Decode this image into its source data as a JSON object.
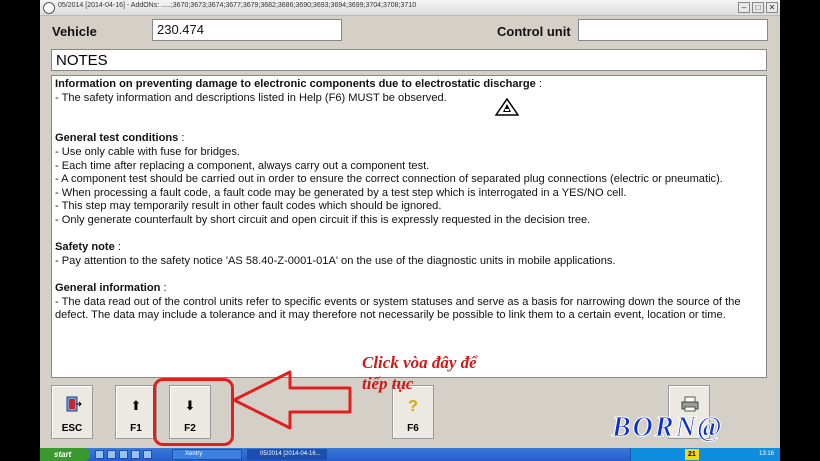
{
  "window": {
    "title": "05/2014 [2014-04-16] - AddONs: .....;3670;3673;3674;3677;3679;3682;3686;3690;3693;3694;3699;3704;3708;3710",
    "minimize": "–",
    "maximize": "□",
    "close": "✕"
  },
  "header": {
    "vehicle_label": "Vehicle",
    "vehicle_value": "230.474",
    "control_unit_label": "Control unit",
    "control_unit_value": ""
  },
  "notes": {
    "title": "NOTES",
    "sections": [
      {
        "heading": "Information on preventing damage to electronic components due to electrostatic discharge",
        "suffix": " :",
        "lines": [
          "- The safety information and descriptions listed in Help (F6) MUST be observed."
        ]
      },
      {
        "heading": "General test conditions",
        "suffix": " :",
        "lines": [
          "- Use only cable with fuse for bridges.",
          "- Each time after replacing a component, always carry out a component test.",
          "- A component test should be carried out in order to ensure the correct connection of separated plug connections (electric or pneumatic).",
          "- When processing a fault code, a fault code may be generated by a test step which is interrogated in a YES/NO cell.",
          "- This step may temporarily result in other fault codes which should be ignored.",
          "- Only generate counterfault by short circuit and open circuit if this is expressly requested in the decision tree."
        ]
      },
      {
        "heading": "Safety note",
        "suffix": " :",
        "lines": [
          "- Pay attention to the safety notice 'AS 58.40-Z-0001-01A' on the use of the diagnostic units in mobile applications."
        ]
      },
      {
        "heading": "General information",
        "suffix": " :",
        "lines": [
          "- The data read out of the control units refer to specific events or system statuses and serve as a basis for narrowing down the source of the defect. The data may include a tolerance and it may therefore not necessarily be possible to link them to a certain event, location or time."
        ]
      }
    ]
  },
  "buttons": {
    "esc": "ESC",
    "f1": "F1",
    "f2": "F2",
    "f6": "F6",
    "f1_glyph": "⬆",
    "f2_glyph": "⬇",
    "f6_glyph": "?"
  },
  "annotation": {
    "line1": "Click vòa đây để",
    "line2": "tiếp tục",
    "color": "#d01818"
  },
  "watermark": "BORN@",
  "taskbar": {
    "start": "start",
    "task1": "Xentry",
    "task2": "05/2014 [2014-04-16...",
    "badge": "21",
    "clock": "13:16"
  }
}
